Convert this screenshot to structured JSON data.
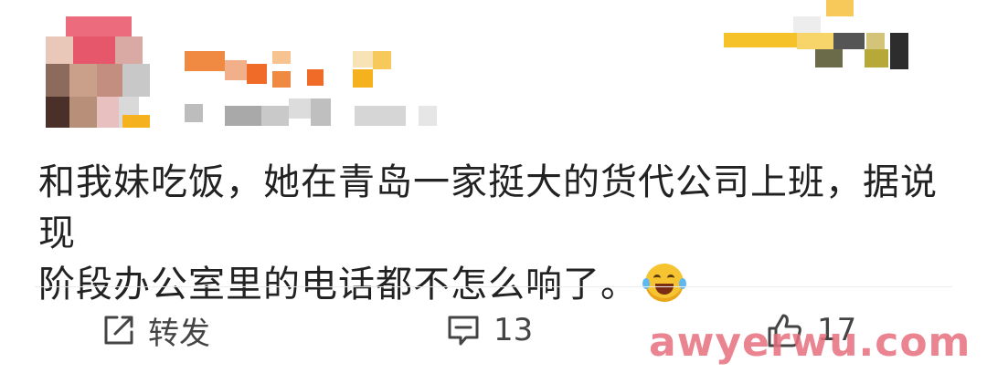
{
  "post": {
    "text_line1": "和我妹吃饭，她在青岛一家挺大的货代公司上班，据说现",
    "text_line2": "阶段办公室里的电话都不怎么响了。",
    "emoji": "laughing-crying-emoji"
  },
  "actions": {
    "repost_label": "转发",
    "comment_count": "13",
    "like_count": "17"
  },
  "watermark": "awyerwu.com",
  "colors": {
    "text": "#222222",
    "action_text": "#444444",
    "divider": "#ececec",
    "watermark": "#e66e7d"
  }
}
